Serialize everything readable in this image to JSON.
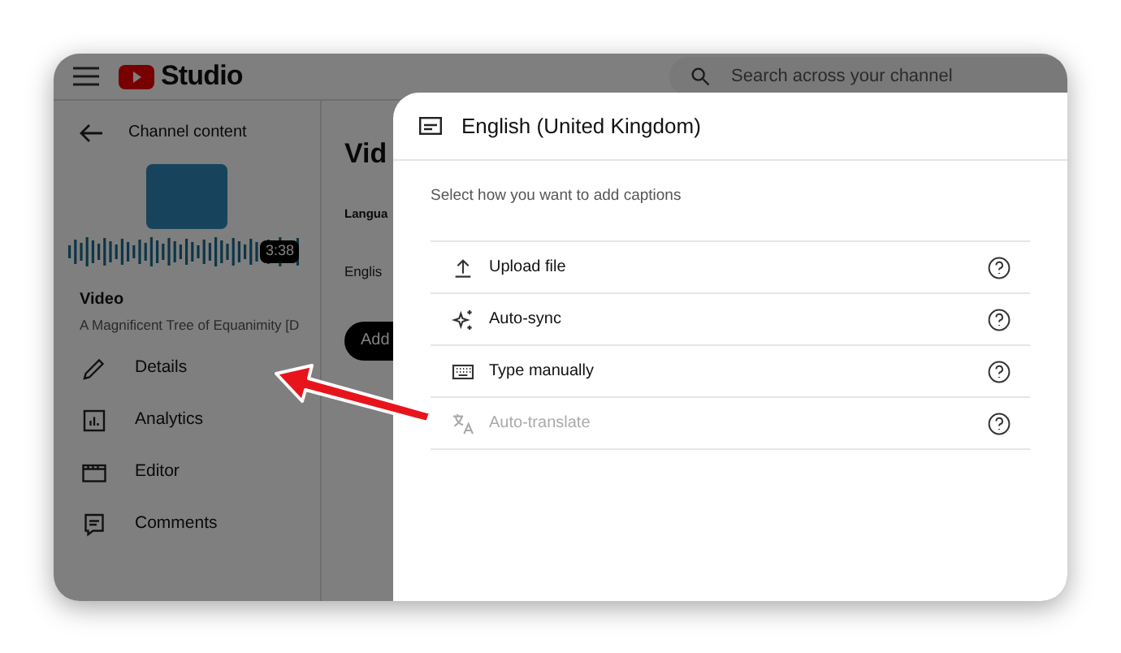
{
  "header": {
    "logo_text": "Studio",
    "search": {
      "placeholder": "Search across your channel"
    }
  },
  "sidebar": {
    "back_label": "Channel content",
    "duration": "3:38",
    "section_title": "Video",
    "video_title": "A Magnificent Tree of Equanimity [D",
    "items": [
      {
        "label": "Details",
        "kind": "details"
      },
      {
        "label": "Analytics",
        "kind": "analytics"
      },
      {
        "label": "Editor",
        "kind": "editor"
      },
      {
        "label": "Comments",
        "kind": "comments"
      }
    ]
  },
  "main": {
    "heading": "Vid",
    "column_header": "Langua",
    "cell": "Englis",
    "button": "Add"
  },
  "dialog": {
    "title": "English (United Kingdom)",
    "subtitle": "Select how you want to add captions",
    "options": [
      {
        "label": "Upload file",
        "kind": "upload",
        "disabled": false
      },
      {
        "label": "Auto-sync",
        "kind": "sync",
        "disabled": false
      },
      {
        "label": "Type manually",
        "kind": "keyboard",
        "disabled": false
      },
      {
        "label": "Auto-translate",
        "kind": "translate",
        "disabled": true
      }
    ]
  }
}
